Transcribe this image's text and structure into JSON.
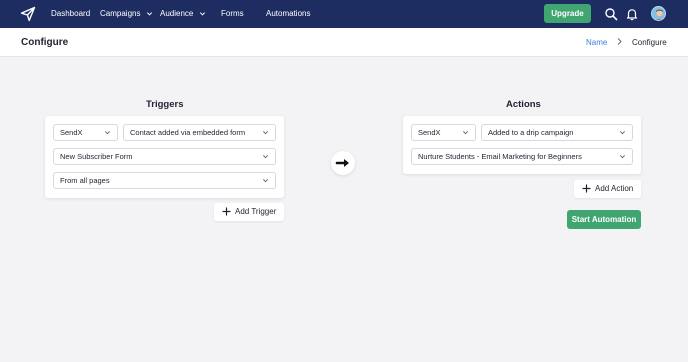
{
  "nav": {
    "items": [
      "Dashboard",
      "Campaigns",
      "Audience",
      "Forms",
      "Automations"
    ],
    "upgrade_label": "Upgrade",
    "bg_color": "#1d2c61",
    "accent_color": "#41a572"
  },
  "header": {
    "title": "Configure",
    "breadcrumb": {
      "link": "Name",
      "current": "Configure"
    }
  },
  "triggers": {
    "title": "Triggers",
    "app_select": "SendX",
    "event_select": "Contact added via embedded form",
    "form_select": "New Subscriber Form",
    "page_select": "From all pages",
    "add_label": "Add Trigger"
  },
  "actions": {
    "title": "Actions",
    "app_select": "SendX",
    "action_select": "Added to a drip campaign",
    "campaign_select": "Nurture Students - Email Marketing for Beginners",
    "add_label": "Add Action"
  },
  "start_label": "Start Automation",
  "icons": [
    "paper-plane-icon",
    "chevron-down-icon",
    "search-icon",
    "bell-icon",
    "avatar",
    "chevron-right-icon",
    "arrow-right-icon",
    "plus-icon"
  ]
}
